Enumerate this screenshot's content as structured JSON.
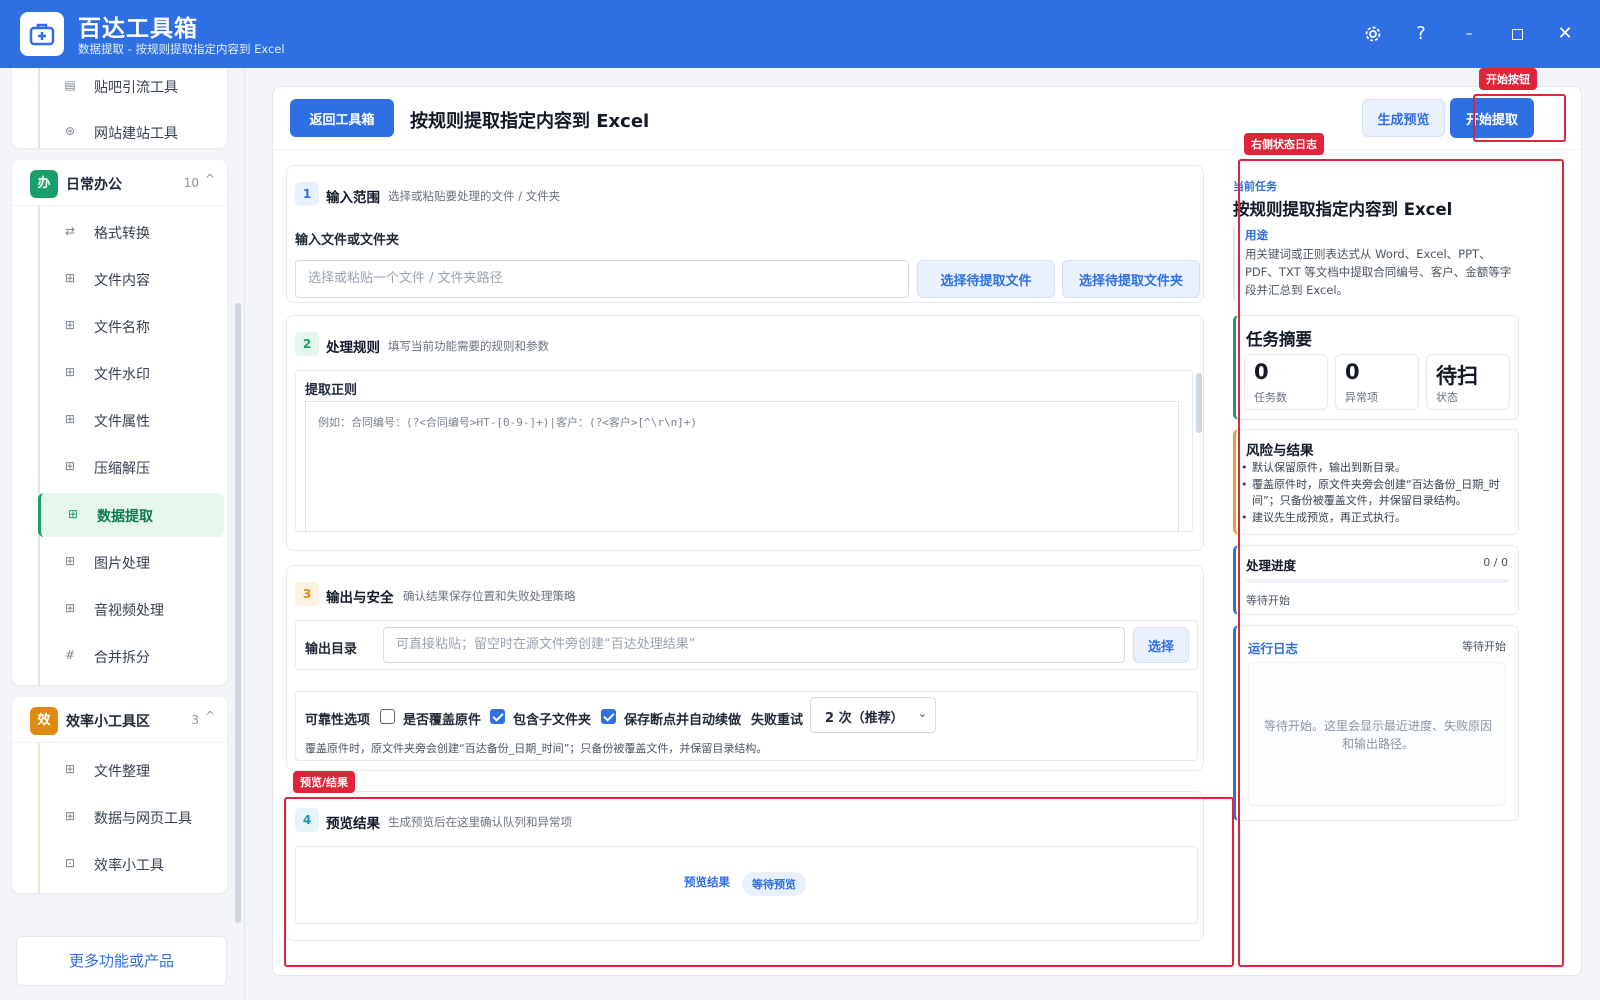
{
  "app": {
    "title": "百达工具箱",
    "subtitle": "数据提取 - 按规则提取指定内容到 Excel"
  },
  "sidebar": {
    "top_items": [
      {
        "label": "贴吧引流工具",
        "icon": "document-icon"
      },
      {
        "label": "网站建站工具",
        "icon": "globe-icon"
      }
    ],
    "groups": [
      {
        "badge": "办",
        "name": "日常办公",
        "count": "10",
        "color": "#19a06a",
        "items": [
          {
            "label": "格式转换",
            "icon": "swap-icon"
          },
          {
            "label": "文件内容",
            "icon": "grid-icon"
          },
          {
            "label": "文件名称",
            "icon": "grid-icon"
          },
          {
            "label": "文件水印",
            "icon": "grid-icon"
          },
          {
            "label": "文件属性",
            "icon": "grid-icon"
          },
          {
            "label": "压缩解压",
            "icon": "grid-icon"
          },
          {
            "label": "数据提取",
            "icon": "grid-icon",
            "active": true
          },
          {
            "label": "图片处理",
            "icon": "grid-icon"
          },
          {
            "label": "音视频处理",
            "icon": "grid-icon"
          },
          {
            "label": "合并拆分",
            "icon": "hash-icon"
          }
        ]
      },
      {
        "badge": "效",
        "name": "效率小工具区",
        "count": "3",
        "color": "#e08a12",
        "items": [
          {
            "label": "文件整理",
            "icon": "grid-icon"
          },
          {
            "label": "数据与网页工具",
            "icon": "grid-icon"
          },
          {
            "label": "效率小工具",
            "icon": "toolbox-icon"
          }
        ]
      }
    ],
    "more_label": "更多功能或产品"
  },
  "header": {
    "back_label": "返回工具箱",
    "title": "按规则提取指定内容到 Excel",
    "preview_label": "生成预览",
    "start_label": "开始提取"
  },
  "section1": {
    "num": "1",
    "title": "输入范围",
    "desc": "选择或粘贴要处理的文件 / 文件夹",
    "field_label": "输入文件或文件夹",
    "placeholder": "选择或粘贴一个文件 / 文件夹路径",
    "pick_file": "选择待提取文件",
    "pick_folder": "选择待提取文件夹"
  },
  "section2": {
    "num": "2",
    "title": "处理规则",
    "desc": "填写当前功能需要的规则和参数",
    "field_label": "提取正则",
    "placeholder": "例如：合同编号：(?<合同编号>HT-[0-9-]+)|客户：(?<客户>[^\\r\\n]+)"
  },
  "section3": {
    "num": "3",
    "title": "输出与安全",
    "desc": "确认结果保存位置和失败处理策略",
    "output_label": "输出目录",
    "output_placeholder": "可直接粘贴；留空时在源文件旁创建“百达处理结果”",
    "choose_label": "选择",
    "reliability_label": "可靠性选项",
    "opt_overwrite": "是否覆盖原件",
    "opt_overwrite_checked": false,
    "opt_subfolders": "包含子文件夹",
    "opt_subfolders_checked": true,
    "opt_resume": "保存断点并自动续做",
    "opt_resume_checked": true,
    "retry_label": "失败重试",
    "retry_value": "2 次（推荐）",
    "note": "覆盖原件时，原文件夹旁会创建“百达备份_日期_时间”；只备份被覆盖文件，并保留目录结构。"
  },
  "section4": {
    "num": "4",
    "title": "预览结果",
    "desc": "生成预览后在这里确认队列和异常项",
    "result_label": "预览结果",
    "status_chip": "等待预览"
  },
  "right_panel": {
    "current_task_label": "当前任务",
    "task_title": "按规则提取指定内容到 Excel",
    "purpose_label": "用途",
    "purpose_text": "用关键词或正则表达式从 Word、Excel、PPT、PDF、TXT 等文档中提取合同编号、客户、金额等字段并汇总到 Excel。",
    "summary_title": "任务摘要",
    "stats": [
      {
        "value": "0",
        "key": "任务数"
      },
      {
        "value": "0",
        "key": "异常项"
      },
      {
        "value": "待扫",
        "key": "状态"
      }
    ],
    "risk_title": "风险与结果",
    "risk_items": [
      "默认保留原件，输出到新目录。",
      "覆盖原件时，原文件夹旁会创建“百达备份_日期_时间”；只备份被覆盖文件，并保留目录结构。",
      "建议先生成预览，再正式执行。"
    ],
    "progress_title": "处理进度",
    "progress_count": "0 / 0",
    "progress_value": 0,
    "progress_status": "等待开始",
    "log_title": "运行日志",
    "log_status": "等待开始",
    "log_placeholder": "等待开始。这里会显示最近进度、失败原因和输出路径。"
  },
  "annotations": {
    "start_button": "开始按钮",
    "right_log": "右侧状态日志",
    "preview_result": "预览/结果"
  },
  "colors": {
    "brand": "#2f6fe4",
    "accent_green": "#19a06a",
    "accent_orange": "#e08a12",
    "annotation_red": "#e0253a"
  }
}
